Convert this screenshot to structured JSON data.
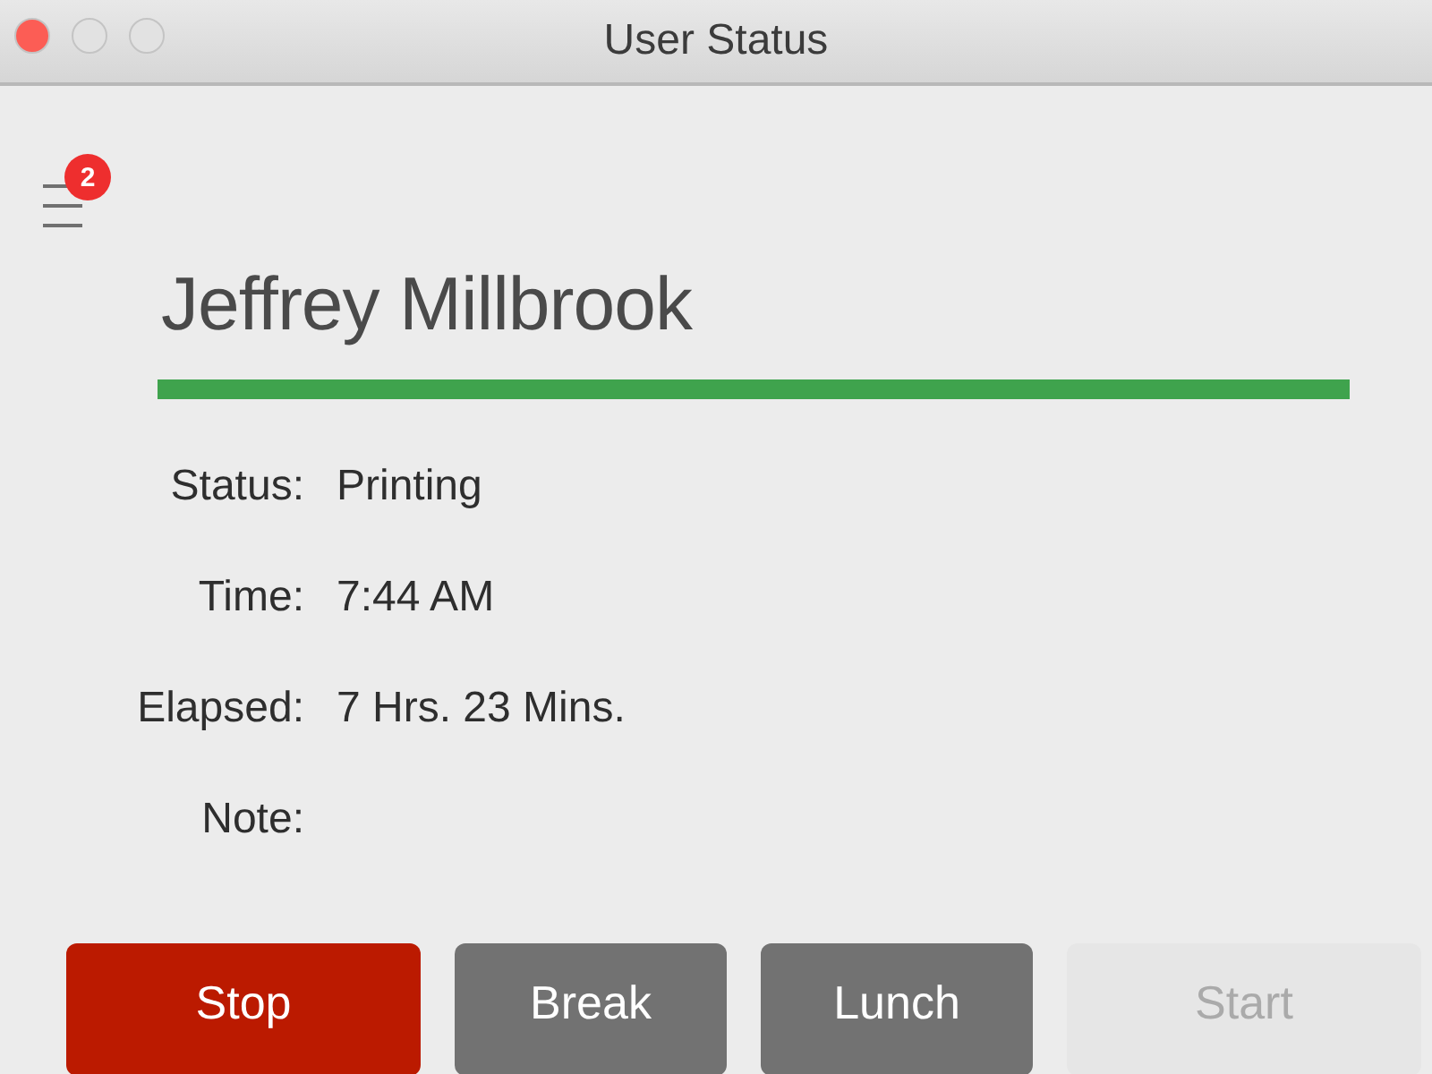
{
  "window": {
    "title": "User Status"
  },
  "menu": {
    "badge": "2"
  },
  "user": {
    "name": "Jeffrey Millbrook"
  },
  "fields": [
    {
      "label": "Status:",
      "value": "Printing"
    },
    {
      "label": "Time:",
      "value": "7:44 AM"
    },
    {
      "label": "Elapsed:",
      "value": "7 Hrs. 23 Mins."
    },
    {
      "label": "Note:"
    }
  ],
  "buttons": [
    {
      "label": "Stop",
      "kind": "danger",
      "disabled": false
    },
    {
      "label": "Break",
      "kind": "neutral",
      "disabled": false
    },
    {
      "label": "Lunch",
      "kind": "neutral",
      "disabled": false
    },
    {
      "label": "Start",
      "kind": "neutral",
      "disabled": true
    }
  ]
}
